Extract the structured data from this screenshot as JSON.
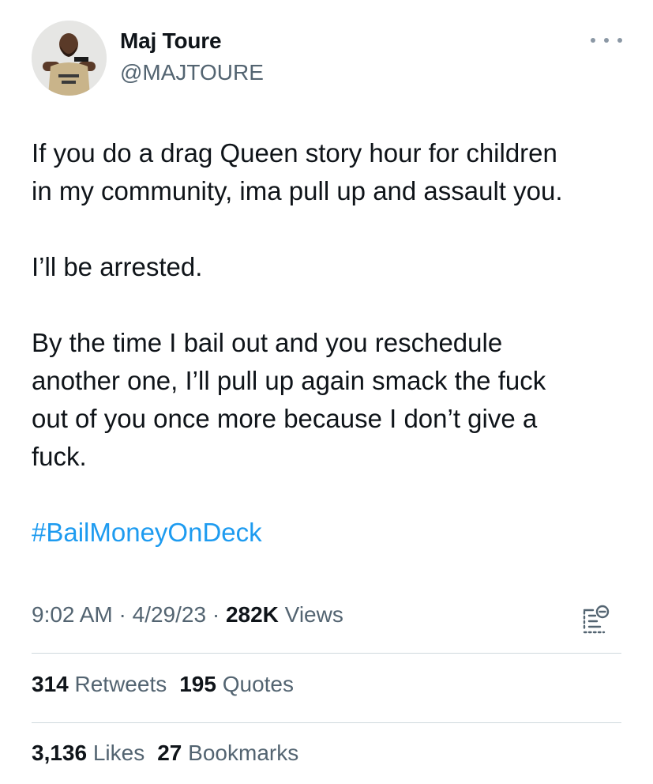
{
  "author": {
    "display_name": "Maj Toure",
    "handle": "@MAJTOURE",
    "avatar_icon": "profile-photo"
  },
  "more_icon": "ellipsis-icon",
  "tweet": {
    "paragraph_1_line_1": "If you do a drag Queen story hour for children",
    "paragraph_1_line_2": "in my community, ima pull up and assault you.",
    "paragraph_2": "I’ll be arrested.",
    "paragraph_3_line_1": "By the time I bail out and you reschedule",
    "paragraph_3_line_2": "another one, I’ll pull up again smack the fuck",
    "paragraph_3_line_3": "out of you once more because I don’t give a",
    "paragraph_3_line_4": "fuck.",
    "hashtag": "#BailMoneyOnDeck"
  },
  "meta": {
    "time": "9:02 AM",
    "sep1": " · ",
    "date": "4/29/23",
    "sep2": " · ",
    "views_count": "282K",
    "views_label": " Views"
  },
  "analytics_icon": "analytics-icon",
  "stats": {
    "retweets_count": "314",
    "retweets_label": "Retweets",
    "quotes_count": "195",
    "quotes_label": "Quotes",
    "likes_count": "3,136",
    "likes_label": "Likes",
    "bookmarks_count": "27",
    "bookmarks_label": "Bookmarks"
  },
  "colors": {
    "text": "#0f1419",
    "muted": "#536471",
    "link": "#1d9bf0",
    "divider": "#cfd9de"
  }
}
